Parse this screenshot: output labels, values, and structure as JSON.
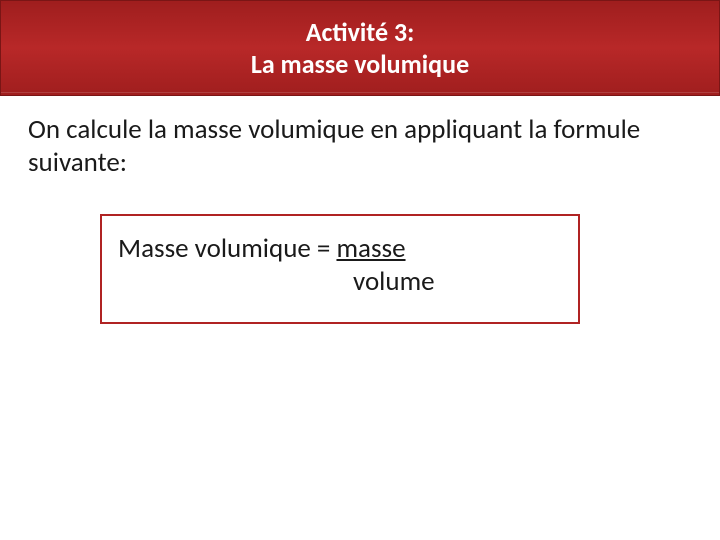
{
  "header": {
    "line1": "Activité 3:",
    "line2": "La masse volumique"
  },
  "body": {
    "intro": "On calcule la masse volumique en appliquant la formule suivante:"
  },
  "formula": {
    "lhs": "Masse volumique = ",
    "numerator": "masse",
    "denominator": "volume"
  }
}
